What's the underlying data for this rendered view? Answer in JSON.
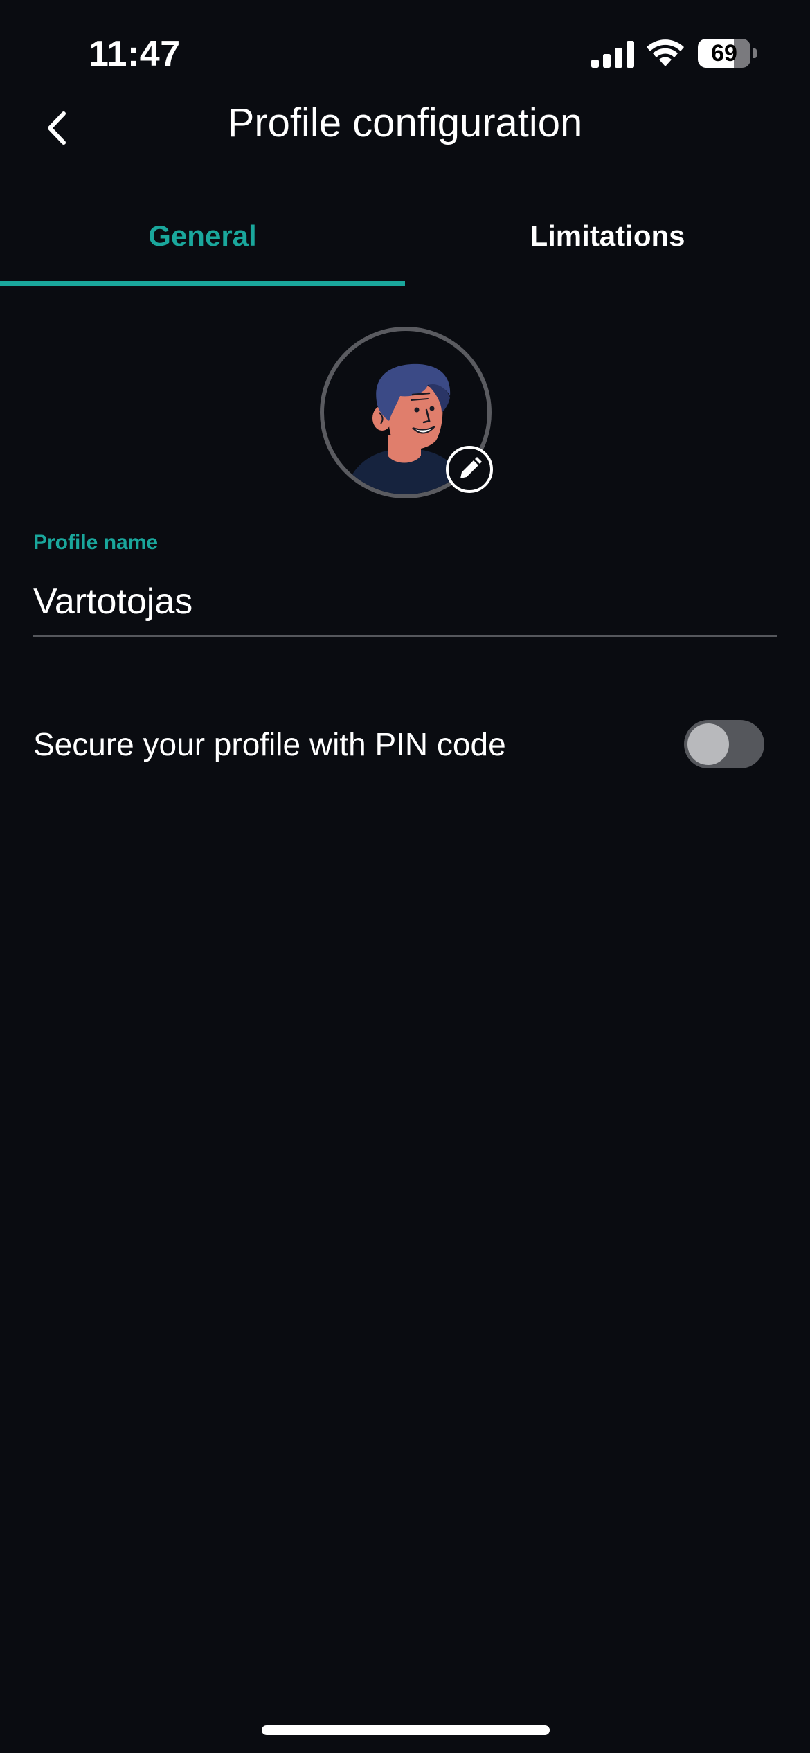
{
  "status_bar": {
    "time": "11:47",
    "battery_level": 69,
    "battery_label": "69",
    "signal_icon": "signal-bars-icon",
    "wifi_icon": "wifi-icon",
    "battery_icon": "battery-icon"
  },
  "header": {
    "title": "Profile configuration",
    "back_icon": "chevron-left-icon"
  },
  "tabs": [
    {
      "label": "General",
      "active": true
    },
    {
      "label": "Limitations",
      "active": false
    }
  ],
  "avatar": {
    "edit_icon": "pencil-icon"
  },
  "profile_name": {
    "label": "Profile name",
    "value": "Vartotojas"
  },
  "pin": {
    "label": "Secure your profile with PIN code",
    "enabled": false
  },
  "colors": {
    "accent": "#1aa79c",
    "background": "#0a0c11",
    "divider": "#55575c"
  }
}
